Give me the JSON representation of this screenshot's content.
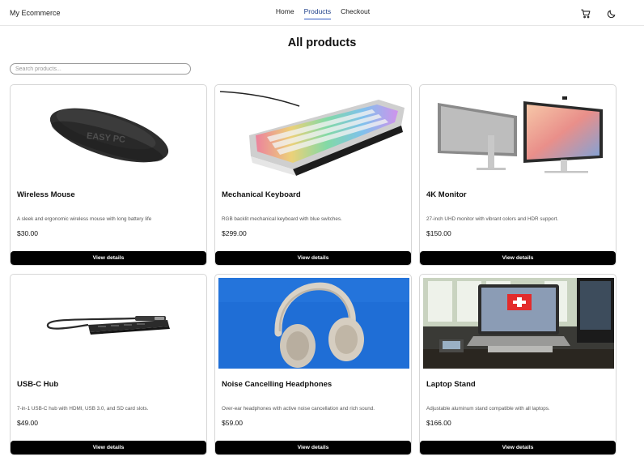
{
  "header": {
    "brand": "My Ecommerce",
    "nav": [
      {
        "label": "Home",
        "active": false
      },
      {
        "label": "Products",
        "active": true
      },
      {
        "label": "Checkout",
        "active": false
      }
    ],
    "icons": [
      "cart-icon",
      "moon-icon"
    ]
  },
  "page": {
    "title": "All products",
    "search_placeholder": "Search products..."
  },
  "products": [
    {
      "name": "Wireless Mouse",
      "description": "A sleek and ergonomic wireless mouse with long battery life",
      "price": "$30.00",
      "button": "View details",
      "image": "mouse-image"
    },
    {
      "name": "Mechanical Keyboard",
      "description": "RGB backlit mechanical keyboard with blue switches.",
      "price": "$299.00",
      "button": "View details",
      "image": "keyboard-image"
    },
    {
      "name": "4K Monitor",
      "description": "27-inch UHD monitor with vibrant colors and HDR support.",
      "price": "$150.00",
      "button": "View details",
      "image": "monitor-image"
    },
    {
      "name": "USB-C Hub",
      "description": "7-in-1 USB-C hub with HDMI, USB 3.0, and SD card slots.",
      "price": "$49.00",
      "button": "View details",
      "image": "usb-hub-image"
    },
    {
      "name": "Noise Cancelling Headphones",
      "description": "Over-ear headphones with active noise cancellation and rich sound.",
      "price": "$59.00",
      "button": "View details",
      "image": "headphones-image"
    },
    {
      "name": "Laptop Stand",
      "description": "Adjustable aluminum stand compatible with all laptops.",
      "price": "$166.00",
      "button": "View details",
      "image": "laptop-stand-image"
    }
  ],
  "image_text": {
    "mouse_logo": "EASY PC"
  },
  "colors": {
    "accent": "#2a55c4",
    "button_bg": "#000000",
    "headphones_bg": "#1f6ed6"
  }
}
